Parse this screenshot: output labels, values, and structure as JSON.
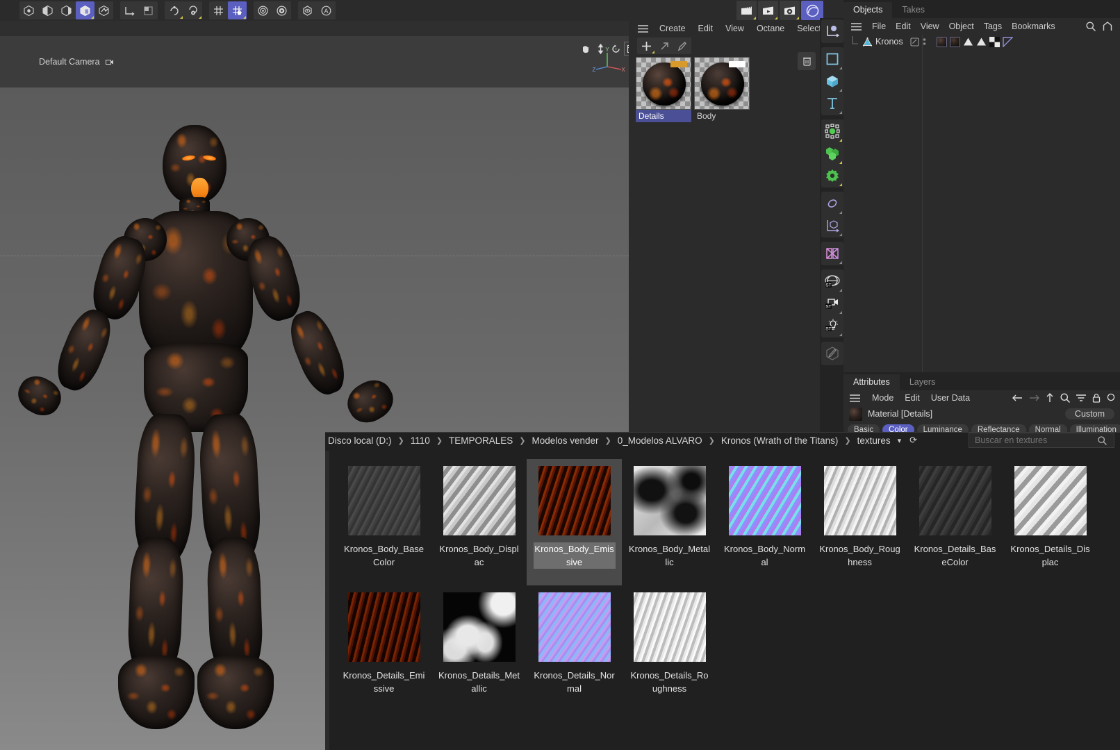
{
  "top_toolbar": {
    "groups": [
      {
        "name": "selection-tools",
        "buttons": [
          {
            "name": "live-selection-icon",
            "selected": false
          },
          {
            "name": "rectangle-selection-icon",
            "selected": false
          },
          {
            "name": "polygon-selection-icon",
            "selected": false
          },
          {
            "name": "move-object-icon",
            "selected": true
          },
          {
            "name": "scale-object-icon",
            "selected": false
          }
        ]
      },
      {
        "name": "coordinate-tools",
        "buttons": [
          {
            "name": "world-axis-icon",
            "selected": false
          },
          {
            "name": "object-axis-icon",
            "selected": false
          }
        ]
      },
      {
        "name": "snap-tools",
        "buttons": [
          {
            "name": "enable-snap-icon",
            "selected": false
          },
          {
            "name": "snap-settings-icon",
            "selected": false
          }
        ]
      },
      {
        "name": "grid-tools",
        "buttons": [
          {
            "name": "workplane-icon",
            "selected": false
          },
          {
            "name": "workplane-lock-icon",
            "selected": true
          }
        ]
      },
      {
        "name": "render-tools",
        "buttons": [
          {
            "name": "render-view-icon",
            "selected": false
          },
          {
            "name": "render-settings-icon",
            "selected": false
          }
        ]
      },
      {
        "name": "misc-tools",
        "buttons": [
          {
            "name": "visibility-icon",
            "selected": false
          },
          {
            "name": "annotation-icon",
            "selected": false
          }
        ]
      }
    ]
  },
  "render_buttons": [
    {
      "name": "render-to-picture-viewer-icon"
    },
    {
      "name": "render-queue-icon"
    },
    {
      "name": "render-settings-icon"
    },
    {
      "name": "octane-render-icon",
      "selected": true
    }
  ],
  "viewport": {
    "camera_label": "Default Camera",
    "nav_icons": [
      "pan-icon",
      "dolly-icon",
      "rotate-icon",
      "maximize-viewport-icon"
    ],
    "menu": {
      "hamburger": "hamburger-icon",
      "items": [
        "Create",
        "Edit",
        "View",
        "Octane",
        "Select"
      ],
      "overflow": "›"
    },
    "axis_labels": {
      "x": "X",
      "y": "Y",
      "z": "Z"
    }
  },
  "material_manager": {
    "menu_items": [
      "Create",
      "Edit",
      "View",
      "Octane",
      "Select"
    ],
    "toolbar_buttons": [
      "add-material-icon",
      "apply-material-icon",
      "pick-material-icon"
    ],
    "trash_button": "delete-material-icon",
    "materials": [
      {
        "name": "Details",
        "selected": true,
        "tag_color": "#d99a2c"
      },
      {
        "name": "Body",
        "selected": false,
        "tag_color": "#ffffff"
      }
    ]
  },
  "vertical_toolbar": {
    "groups": [
      {
        "items": [
          {
            "name": "axis-object-icon"
          }
        ]
      },
      {
        "items": [
          {
            "name": "spline-rectangle-icon"
          },
          {
            "name": "cube-primitive-icon"
          },
          {
            "name": "text-spline-icon"
          }
        ]
      },
      {
        "items": [
          {
            "name": "nurbs-generator-icon"
          },
          {
            "name": "array-modeling-icon"
          },
          {
            "name": "deformer-icon"
          }
        ]
      },
      {
        "items": [
          {
            "name": "environment-icon"
          },
          {
            "name": "scene-axis-icon"
          }
        ]
      },
      {
        "items": [
          {
            "name": "mograph-icon"
          }
        ]
      },
      {
        "items": [
          {
            "name": "octane-environment-icon"
          },
          {
            "name": "octane-camera-icon"
          },
          {
            "name": "octane-light-icon"
          }
        ]
      },
      {
        "items": [
          {
            "name": "paint-tool-icon"
          }
        ]
      }
    ]
  },
  "object_manager": {
    "tabs": [
      {
        "label": "Objects",
        "active": true
      },
      {
        "label": "Takes",
        "active": false
      }
    ],
    "menu_items": [
      "File",
      "Edit",
      "View",
      "Object",
      "Tags",
      "Bookmarks"
    ],
    "menu_right_icons": [
      "search-icon",
      "home-icon"
    ],
    "hamburger": "hamburger-icon",
    "objects": [
      {
        "name": "Kronos",
        "type_icon": "polygon-object-icon",
        "visibility_icons": [
          "visible-editor-dot",
          "visible-render-dot"
        ],
        "tags": [
          {
            "name": "material-tag-details"
          },
          {
            "name": "material-tag-body"
          },
          {
            "name": "selection-tag-1"
          },
          {
            "name": "selection-tag-2"
          },
          {
            "name": "uvw-tag"
          },
          {
            "name": "phong-tag"
          }
        ]
      }
    ]
  },
  "attribute_manager": {
    "tabs": [
      {
        "label": "Attributes",
        "active": true
      },
      {
        "label": "Layers",
        "active": false
      }
    ],
    "menu_items": [
      "Mode",
      "Edit",
      "User Data"
    ],
    "hamburger": "hamburger-icon",
    "nav_icons": [
      "back-arrow-icon",
      "forward-arrow-icon",
      "up-arrow-icon",
      "search-icon",
      "filter-icon",
      "lock-icon",
      "pin-icon"
    ],
    "material_title": "Material [Details]",
    "preset_label": "Custom",
    "channel_tabs": [
      {
        "label": "Basic",
        "active": false
      },
      {
        "label": "Color",
        "active": true
      },
      {
        "label": "Luminance",
        "active": false
      },
      {
        "label": "Reflectance",
        "active": false
      },
      {
        "label": "Normal",
        "active": false
      },
      {
        "label": "Illumination",
        "active": false
      }
    ]
  },
  "explorer": {
    "breadcrumbs": [
      "Disco local (D:)",
      "1110",
      "TEMPORALES",
      "Modelos vender",
      "0_Modelos ALVARO",
      "Kronos (Wrath of the Titans)",
      "textures"
    ],
    "breadcrumb_caret": "chevron-down-icon",
    "refresh_icon": "refresh-icon",
    "search_placeholder": "Buscar en textures",
    "search_value": "",
    "search_icon": "search-icon",
    "files": [
      {
        "name": "Kronos_Body_BaseColor",
        "thumb": "tx-basecolor",
        "selected": false
      },
      {
        "name": "Kronos_Body_Displac",
        "thumb": "tx-displac",
        "selected": false
      },
      {
        "name": "Kronos_Body_Emissive",
        "thumb": "tx-emissive",
        "selected": true
      },
      {
        "name": "Kronos_Body_Metallic",
        "thumb": "tx-metallic",
        "selected": false
      },
      {
        "name": "Kronos_Body_Normal",
        "thumb": "tx-normal",
        "selected": false
      },
      {
        "name": "Kronos_Body_Roughness",
        "thumb": "tx-roughness",
        "selected": false
      },
      {
        "name": "Kronos_Details_BaseColor",
        "thumb": "tx-dbasecolor",
        "selected": false
      },
      {
        "name": "Kronos_Details_Displac",
        "thumb": "tx-ddisplac",
        "selected": false
      },
      {
        "name": "Kronos_Details_Emissive",
        "thumb": "tx-demissive",
        "selected": false
      },
      {
        "name": "Kronos_Details_Metallic",
        "thumb": "tx-dmetallic",
        "selected": false
      },
      {
        "name": "Kronos_Details_Normal",
        "thumb": "tx-dnormal",
        "selected": false
      },
      {
        "name": "Kronos_Details_Roughness",
        "thumb": "tx-droughness",
        "selected": false
      }
    ]
  },
  "colors": {
    "accent": "#5a5fc0",
    "panel_bg": "#2b2b2b",
    "explorer_bg": "#202020",
    "selection": "#4a4a4a"
  }
}
